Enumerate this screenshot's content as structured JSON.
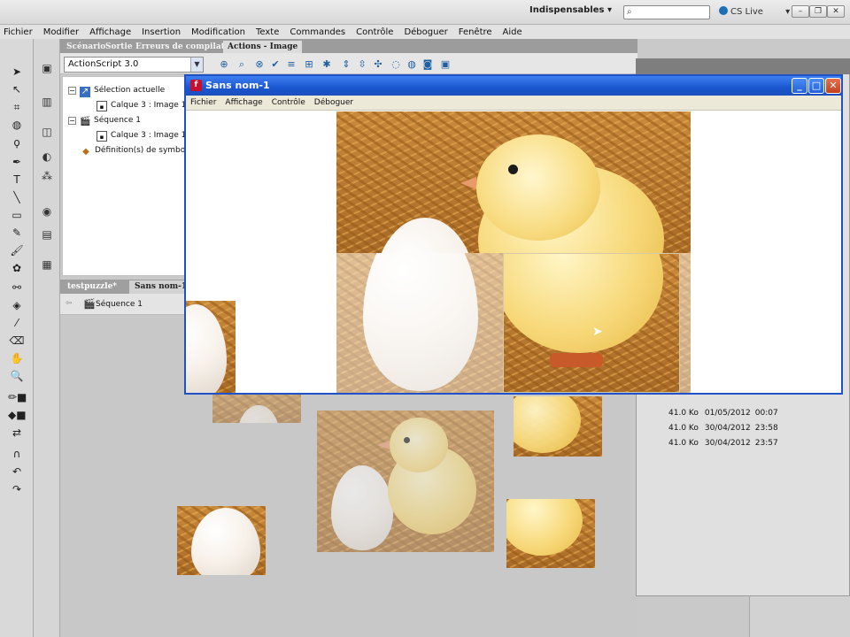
{
  "menubar": {
    "items": [
      "Fichier",
      "Modifier",
      "Affichage",
      "Insertion",
      "Modification",
      "Texte",
      "Commandes",
      "Contrôle",
      "Déboguer",
      "Fenêtre",
      "Aide"
    ]
  },
  "topbar": {
    "workspace": "Indispensables",
    "search_placeholder": "",
    "cslive": "CS Live"
  },
  "panel_tabs": [
    "Scénario",
    "Sortie",
    "Erreurs de compilation",
    "Actions - Image"
  ],
  "actions": {
    "script_version": "ActionScript 3.0",
    "tree": {
      "current_selection": "Sélection actuelle",
      "layer_frame_1": "Calque 3 : Image 1",
      "scene": "Séquence 1",
      "layer_frame_2": "Calque 3 : Image 1",
      "symbols": "Définition(s) de symbole"
    }
  },
  "doc_tabs": [
    "testpuzzle*",
    "Sans nom-1"
  ],
  "scene_label": "Séquence 1",
  "player": {
    "title": "Sans nom-1",
    "menu": [
      "Fichier",
      "Affichage",
      "Contrôle",
      "Déboguer"
    ]
  },
  "library_rows": [
    {
      "size": "41.0 Ko",
      "date": "01/05/2012",
      "time": "00:07"
    },
    {
      "size": "41.0 Ko",
      "date": "30/04/2012",
      "time": "23:58"
    },
    {
      "size": "41.0 Ko",
      "date": "30/04/2012",
      "time": "23:57"
    }
  ],
  "colors": {
    "xp_title": "#1a56d0",
    "panel_dark": "#9c9c9c",
    "stage_bg": "#c8c8c8"
  }
}
